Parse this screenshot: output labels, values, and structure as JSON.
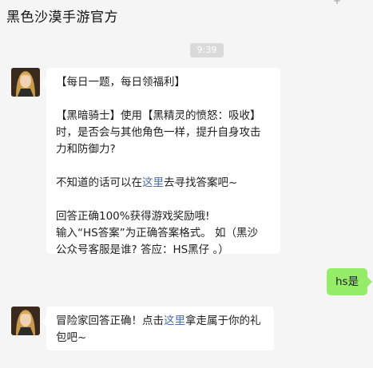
{
  "header": {
    "title": "黑色沙漠手游官方",
    "more_glyph": "+"
  },
  "timestamp": "9:39",
  "messages": {
    "first": {
      "line1": "【每日一题，每日领福利】",
      "line2": "【黑暗骑士】使用【黑精灵的愤怒：吸收】",
      "line3": "时，是否会与其他角色一样，提升自身攻击",
      "line4": "力和防御力?",
      "line5_pre": "不知道的话可以在",
      "line5_link": "这里",
      "line5_post": "去寻找答案吧~",
      "line6": "回答正确100%获得游戏奖励哦!",
      "line7": "输入“HS答案”为正确答案格式。 如（黑沙",
      "line8": "公众号客服是谁? 答应：HS黑仔 。）"
    },
    "reply": "hs是",
    "second": {
      "line1_pre": "冒险家回答正确！点击",
      "line1_link": "这里",
      "line1_post": "拿走属于你的礼",
      "line2": "包吧~"
    }
  },
  "colors": {
    "background": "#f5f5f5",
    "bubble_incoming": "#ffffff",
    "bubble_outgoing": "#95ec69",
    "link": "#4b6fa5"
  }
}
